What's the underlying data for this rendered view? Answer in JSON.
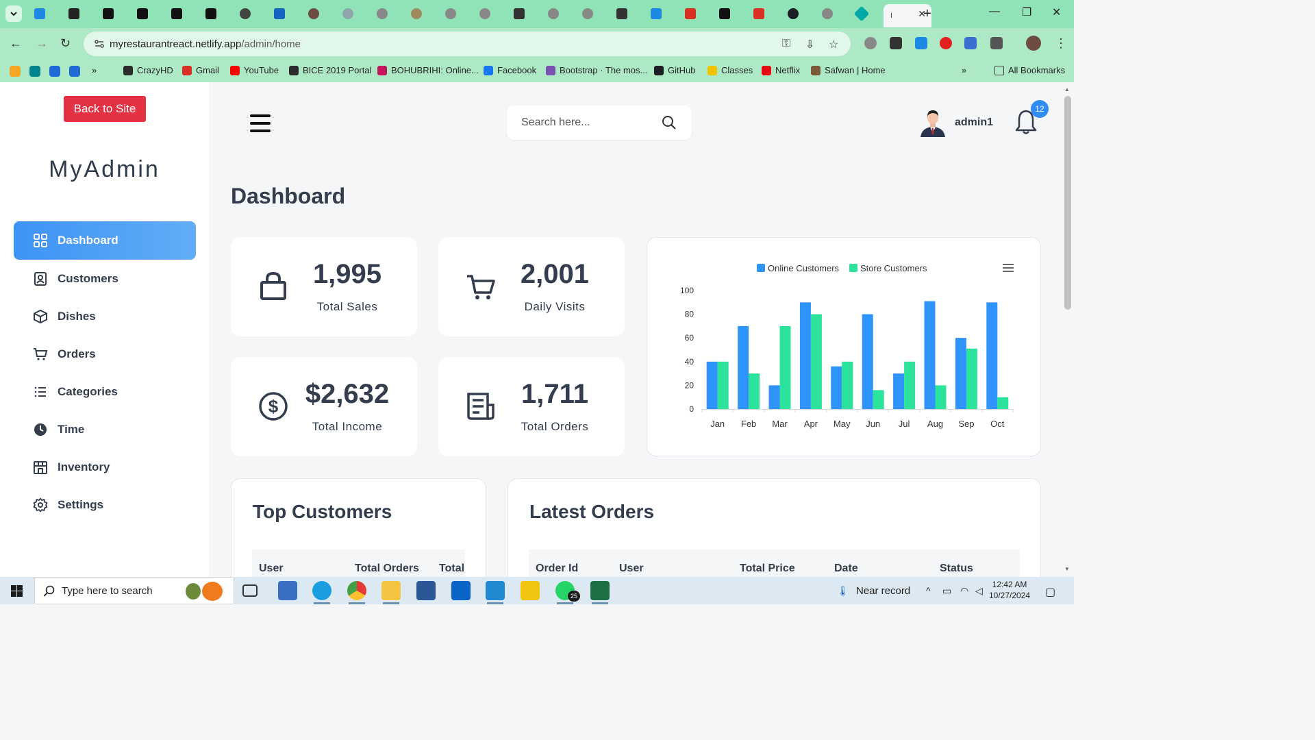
{
  "browser": {
    "url_domain": "myrestaurantreact.netlify.app",
    "url_path": "/admin/home",
    "active_tab_title": "I",
    "bookmarks": [
      {
        "label": "CrazyHD",
        "color": "#2b2b2b"
      },
      {
        "label": "Gmail",
        "color": "#d93025"
      },
      {
        "label": "YouTube",
        "color": "#ff0000"
      },
      {
        "label": "BICE 2019 Portal",
        "color": "#2b2b2b"
      },
      {
        "label": "BOHUBRIHI: Online...",
        "color": "#c2185b"
      },
      {
        "label": "Facebook",
        "color": "#1877f2"
      },
      {
        "label": "Bootstrap · The mos...",
        "color": "#7952b3"
      },
      {
        "label": "GitHub",
        "color": "#1b1f23"
      },
      {
        "label": "Classes",
        "color": "#f2c400"
      },
      {
        "label": "Netflix",
        "color": "#e50914"
      },
      {
        "label": "Safwan | Home",
        "color": "#7a5a3a"
      }
    ],
    "all_bookmarks_label": "All Bookmarks"
  },
  "sidebar": {
    "back_label": "Back to Site",
    "brand": "MyAdmin",
    "items": [
      {
        "label": "Dashboard",
        "icon": "grid-icon"
      },
      {
        "label": "Customers",
        "icon": "contact-icon"
      },
      {
        "label": "Dishes",
        "icon": "box-icon"
      },
      {
        "label": "Orders",
        "icon": "cart-icon"
      },
      {
        "label": "Categories",
        "icon": "list-icon"
      },
      {
        "label": "Time",
        "icon": "clock-icon"
      },
      {
        "label": "Inventory",
        "icon": "storefront-icon"
      },
      {
        "label": "Settings",
        "icon": "gear-icon"
      }
    ]
  },
  "header": {
    "search_placeholder": "Search here...",
    "username": "admin1",
    "notification_count": "12"
  },
  "page_title": "Dashboard",
  "stats": [
    {
      "value": "1,995",
      "label": "Total Sales",
      "icon": "bag-icon"
    },
    {
      "value": "2,001",
      "label": "Daily Visits",
      "icon": "cart-icon"
    },
    {
      "value": "$2,632",
      "label": "Total Income",
      "icon": "dollar-icon"
    },
    {
      "value": "1,711",
      "label": "Total Orders",
      "icon": "receipt-icon"
    }
  ],
  "chart_data": {
    "type": "bar",
    "categories": [
      "Jan",
      "Feb",
      "Mar",
      "Apr",
      "May",
      "Jun",
      "Jul",
      "Aug",
      "Sep",
      "Oct"
    ],
    "series": [
      {
        "name": "Online Customers",
        "color": "#2e93fa",
        "values": [
          40,
          70,
          20,
          90,
          36,
          80,
          30,
          91,
          60,
          90
        ]
      },
      {
        "name": "Store Customers",
        "color": "#2be39a",
        "values": [
          40,
          30,
          70,
          80,
          40,
          16,
          40,
          20,
          51,
          10
        ]
      }
    ],
    "ylim": [
      0,
      100
    ],
    "yticks": [
      0,
      20,
      40,
      60,
      80,
      100
    ],
    "legend": "top-center",
    "grid": false
  },
  "top_customers": {
    "title": "Top Customers",
    "columns": [
      "User",
      "Total Orders",
      "Total"
    ]
  },
  "latest_orders": {
    "title": "Latest Orders",
    "columns": [
      "Order Id",
      "User",
      "Total Price",
      "Date",
      "Status"
    ]
  },
  "taskbar": {
    "search_placeholder": "Type here to search",
    "weather": "Near record",
    "time": "12:42 AM",
    "date": "10/27/2024",
    "whatsapp_badge": "25"
  }
}
